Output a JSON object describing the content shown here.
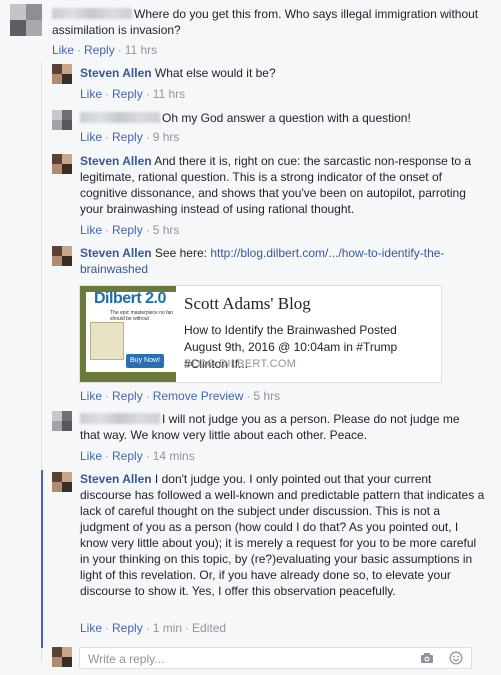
{
  "actions": {
    "like": "Like",
    "reply": "Reply",
    "sep": "·",
    "remove_preview": "Remove Preview",
    "edited": "Edited"
  },
  "comments": [
    {
      "author": "",
      "text": "Where do you get this from. Who says illegal immigration without assimilation is invasion?",
      "time": "11 hrs"
    },
    {
      "author": "Steven Allen",
      "text": "What else would it be?",
      "time": "11 hrs"
    },
    {
      "author": "",
      "text": "Oh my God answer a question with a question!",
      "time": "9 hrs"
    },
    {
      "author": "Steven Allen",
      "text": "And there it is, right on cue: the sarcastic non-response to a legitimate, rational question. This is a strong indicator of the onset of cognitive dissonance, and shows that you've been on autopilot, parroting your brainwashing instead of using rational thought.",
      "time": "5 hrs"
    },
    {
      "author": "Steven Allen",
      "text": "See here:",
      "link": "http://blog.dilbert.com/.../how-to-identify-the-brainwashed",
      "time": "5 hrs"
    },
    {
      "author": "",
      "text": "I will not judge you as a person. Please do not judge me that way. We know very little about each other. Peace.",
      "time": "14 mins"
    },
    {
      "author": "Steven Allen",
      "text": "I don't judge you. I only pointed out that your current discourse has followed a well-known and predictable pattern that indicates a lack of careful thought on the subject under discussion. This is not a judgment of you as a person (how could I do that? As you pointed out, I know very little about you); it is merely a request for you to be more careful in your thinking on this topic, by (re?)evaluating your basic assumptions in light of this revelation. Or, if you have already done so, to elevate your discourse to show it. Yes, I offer this observation peacefully.",
      "time": "1 min"
    }
  ],
  "preview": {
    "title": "Scott Adams' Blog",
    "description": "How to Identify the Brainwashed Posted August 9th, 2016 @ 10:04am in #Trump #Clinton If...",
    "domain": "BLOG.DILBERT.COM",
    "thumb_title": "Dilbert 2.0",
    "thumb_tag": "The epic masterpiece no fan should be without",
    "thumb_button": "Buy Now!"
  },
  "reply_box": {
    "placeholder": "Write a reply..."
  },
  "colors": {
    "link": "#365899",
    "action": "#4267b2",
    "meta": "#90949c",
    "thread_line": "#4267b2"
  },
  "icons": [
    "camera-icon",
    "emoji-icon"
  ]
}
